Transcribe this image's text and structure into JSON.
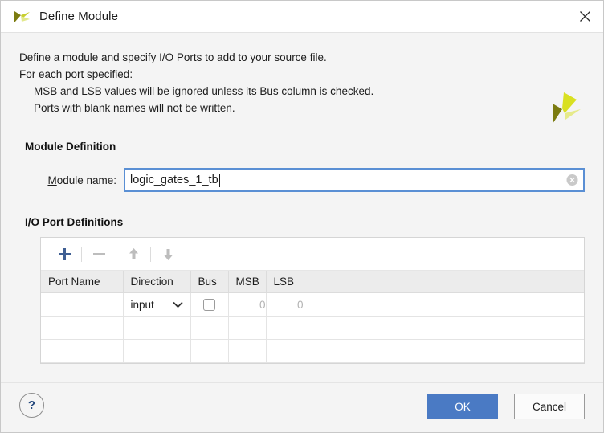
{
  "window": {
    "title": "Define Module",
    "app_icon": "vivado-logo-icon",
    "close_icon": "close-icon"
  },
  "intro": {
    "line1": "Define a module and specify I/O Ports to add to your source file.",
    "line2": "For each port specified:",
    "line3": "MSB and LSB values will be ignored unless its Bus column is checked.",
    "line4": "Ports with blank names will not be written."
  },
  "brand": {
    "icon": "xilinx-logo-icon",
    "colors": {
      "dark": "#7b7b10",
      "bright": "#d9e021",
      "light": "#e6ea8a"
    }
  },
  "module_definition": {
    "heading": "Module Definition",
    "name_label_prefix": "M",
    "name_label_rest": "odule name:",
    "name_value": "logic_gates_1_tb",
    "clear_icon": "clear-circle-icon",
    "focus_color": "#5a8fd4"
  },
  "io_ports": {
    "heading": "I/O Port Definitions",
    "toolbar": [
      {
        "name": "add-port-button",
        "icon": "plus-icon",
        "enabled": true
      },
      {
        "name": "remove-port-button",
        "icon": "minus-icon",
        "enabled": false
      },
      {
        "name": "move-port-up-button",
        "icon": "arrow-up-icon",
        "enabled": false
      },
      {
        "name": "move-port-down-button",
        "icon": "arrow-down-icon",
        "enabled": false
      }
    ],
    "columns": [
      "Port Name",
      "Direction",
      "Bus",
      "MSB",
      "LSB",
      ""
    ],
    "rows": [
      {
        "port_name": "",
        "direction": "input",
        "bus_checked": false,
        "msb": "0",
        "lsb": "0"
      },
      {
        "port_name": "",
        "direction": "",
        "bus_checked": null,
        "msb": "",
        "lsb": ""
      },
      {
        "port_name": "",
        "direction": "",
        "bus_checked": null,
        "msb": "",
        "lsb": ""
      }
    ]
  },
  "footer": {
    "help_label": "?",
    "ok_label": "OK",
    "cancel_label": "Cancel",
    "ok_color": "#4a7ac4"
  }
}
